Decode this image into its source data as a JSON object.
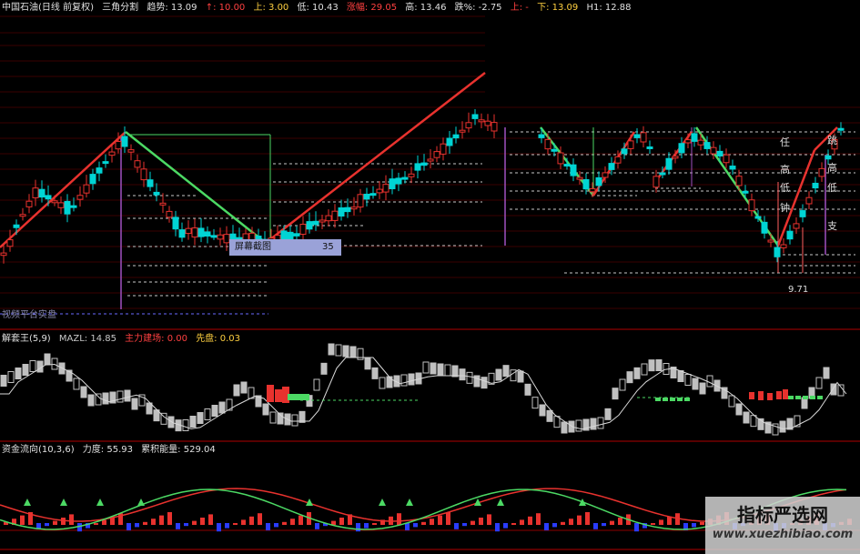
{
  "main_header": {
    "name": "中国石油(日线 前复权)",
    "indicator": "三角分割",
    "trend_label": "趋势: 13.09",
    "up_label": "↑: 10.00",
    "down_label": "上: 3.00",
    "low_label": "低: 10.43",
    "drop_label": "涨幅: 29.05",
    "high_label": "高: 13.46",
    "change_label": "跌%: -2.75",
    "up2": "上: -",
    "down2": "下: 13.09",
    "h1_label": "H1: 12.88"
  },
  "tooltip": {
    "left": "屏幕截图",
    "right": "35"
  },
  "main_footer_label": "视频平台实盘",
  "price_label": "9.71",
  "side_chars": [
    "任",
    "高",
    "低",
    "钟",
    "跳",
    "高",
    "低",
    "支"
  ],
  "panel2_header": {
    "name": "解套王(5,9)",
    "mazl": "MAZL: 14.85",
    "main": "主力建场: 0.00",
    "first": "先盘: 0.03"
  },
  "panel3_header": {
    "name": "资金流向(10,3,6)",
    "force": "力度: 55.93",
    "energy": "累积能量: 529.04"
  },
  "watermark": {
    "title": "指标严选网",
    "url": "www.xuezhibiao.com"
  },
  "colors": {
    "up": "#e8322e",
    "down": "#00d4d4",
    "green": "#4cd964",
    "red": "#e8322e",
    "grid": "#8b0000",
    "gray": "#c0c0c0",
    "blue": "#2a3cff"
  }
}
